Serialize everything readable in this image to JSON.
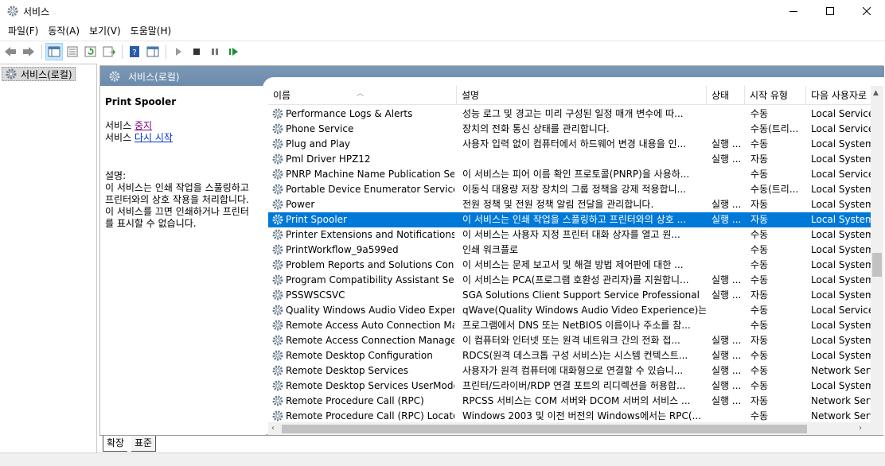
{
  "window": {
    "title": "서비스"
  },
  "menu": [
    "파일(F)",
    "동작(A)",
    "보기(V)",
    "도움말(H)"
  ],
  "tree": {
    "root_label": "서비스(로컬)"
  },
  "panel": {
    "header_title": "서비스(로컬)"
  },
  "details": {
    "service_name": "Print Spooler",
    "line1_prefix": "서비스 ",
    "stop_link": "중지",
    "line2_prefix": "서비스 ",
    "restart_link": "다시 시작",
    "desc_label": "설명:",
    "desc_lines": [
      "이 서비스는 인쇄 작업을 스풀링하고",
      "프린터와의 상호 작용을 처리합니다.",
      "이 서비스를 끄면 인쇄하거나 프린터",
      "를 표시할 수 없습니다."
    ]
  },
  "columns": {
    "name": "이름",
    "description": "설명",
    "status": "상태",
    "startup": "시작 유형",
    "logon": "다음 사용자로"
  },
  "services": [
    {
      "name": "Performance Logs & Alerts",
      "description": "성능 로그 및 경고는 미리 구성된 일정 매개 변수에 따...",
      "status": "",
      "startup": "수동",
      "logon": "Local Service"
    },
    {
      "name": "Phone Service",
      "description": "장치의 전화 통신 상태를 관리합니다.",
      "status": "",
      "startup": "수동(트리...",
      "logon": "Local Service"
    },
    {
      "name": "Plug and Play",
      "description": "사용자 입력 없이 컴퓨터에서 하드웨어 변경 내용을 인...",
      "status": "실행 ...",
      "startup": "수동",
      "logon": "Local System"
    },
    {
      "name": "Pml Driver HPZ12",
      "description": "",
      "status": "실행 ...",
      "startup": "자동",
      "logon": "Local System"
    },
    {
      "name": "PNRP Machine Name Publication Ser...",
      "description": "이 서비스는 피어 이름 확인 프로토콜(PNRP)을 사용하...",
      "status": "",
      "startup": "수동",
      "logon": "Local Service"
    },
    {
      "name": "Portable Device Enumerator Service",
      "description": "이동식 대용량 저장 장치의 그룹 정책을 강제 적용합니...",
      "status": "",
      "startup": "수동(트리...",
      "logon": "Local System"
    },
    {
      "name": "Power",
      "description": "전원 정책 및 전원 정책 알림 전달을 관리합니다.",
      "status": "실행 ...",
      "startup": "자동",
      "logon": "Local System"
    },
    {
      "name": "Print Spooler",
      "description": "이 서비스는 인쇄 작업을 스풀링하고 프린터와의 상호 ...",
      "status": "실행 ...",
      "startup": "자동",
      "logon": "Local System",
      "selected": true
    },
    {
      "name": "Printer Extensions and Notifications",
      "description": "이 서비스는 사용자 지정 프린터 대화 상자를 열고 원...",
      "status": "",
      "startup": "수동",
      "logon": "Local System"
    },
    {
      "name": "PrintWorkflow_9a599ed",
      "description": "인쇄 워크플로",
      "status": "",
      "startup": "수동",
      "logon": "Local System"
    },
    {
      "name": "Problem Reports and Solutions Contr...",
      "description": "이 서비스는 문제 보고서 및 해결 방법 제어판에 대한 ...",
      "status": "",
      "startup": "수동",
      "logon": "Local System"
    },
    {
      "name": "Program Compatibility Assistant Servi...",
      "description": "이 서비스는 PCA(프로그램 호환성 관리자)를 지원합니...",
      "status": "실행 ...",
      "startup": "수동",
      "logon": "Local System"
    },
    {
      "name": "PSSWSCSVC",
      "description": "SGA Solutions Client Support Service Professional",
      "status": "실행 ...",
      "startup": "자동",
      "logon": "Local System"
    },
    {
      "name": "Quality Windows Audio Video Experie...",
      "description": "qWave(Quality Windows Audio Video Experience)는 I...",
      "status": "",
      "startup": "수동",
      "logon": "Local Service"
    },
    {
      "name": "Remote Access Auto Connection Ma...",
      "description": "프로그램에서 DNS 또는 NetBIOS 이름이나 주소를 참...",
      "status": "",
      "startup": "수동",
      "logon": "Local System"
    },
    {
      "name": "Remote Access Connection Manager",
      "description": "이 컴퓨터와 인터넷 또는 원격 네트워크 간의 전화 접...",
      "status": "실행 ...",
      "startup": "자동",
      "logon": "Local System"
    },
    {
      "name": "Remote Desktop Configuration",
      "description": "RDCS(원격 데스크톱 구성 서비스)는 시스템 컨텍스트...",
      "status": "실행 ...",
      "startup": "수동",
      "logon": "Local System"
    },
    {
      "name": "Remote Desktop Services",
      "description": "사용자가 원격 컴퓨터에 대화형으로 연결할 수 있습니...",
      "status": "실행 ...",
      "startup": "수동",
      "logon": "Network Serv"
    },
    {
      "name": "Remote Desktop Services UserMode ...",
      "description": "프린터/드라이버/RDP 연결 포트의 리디렉션을 허용합...",
      "status": "실행 ...",
      "startup": "수동",
      "logon": "Local System"
    },
    {
      "name": "Remote Procedure Call (RPC)",
      "description": "RPCSS 서비스는 COM 서버와 DCOM 서버의 서비스 ...",
      "status": "실행 ...",
      "startup": "자동",
      "logon": "Network Serv"
    },
    {
      "name": "Remote Procedure Call (RPC) Locator",
      "description": "Windows 2003 및 이전 버전의 Windows에서는 RPC(...",
      "status": "",
      "startup": "수동",
      "logon": "Network Serv"
    }
  ],
  "bottom_tabs": [
    "확장",
    "표준"
  ],
  "colors": {
    "selection": "#0078d7",
    "panel_header": "#7b98b6",
    "link": "#0033cc",
    "visited_link": "#800080"
  },
  "icons": {
    "service": "gear-icon"
  }
}
